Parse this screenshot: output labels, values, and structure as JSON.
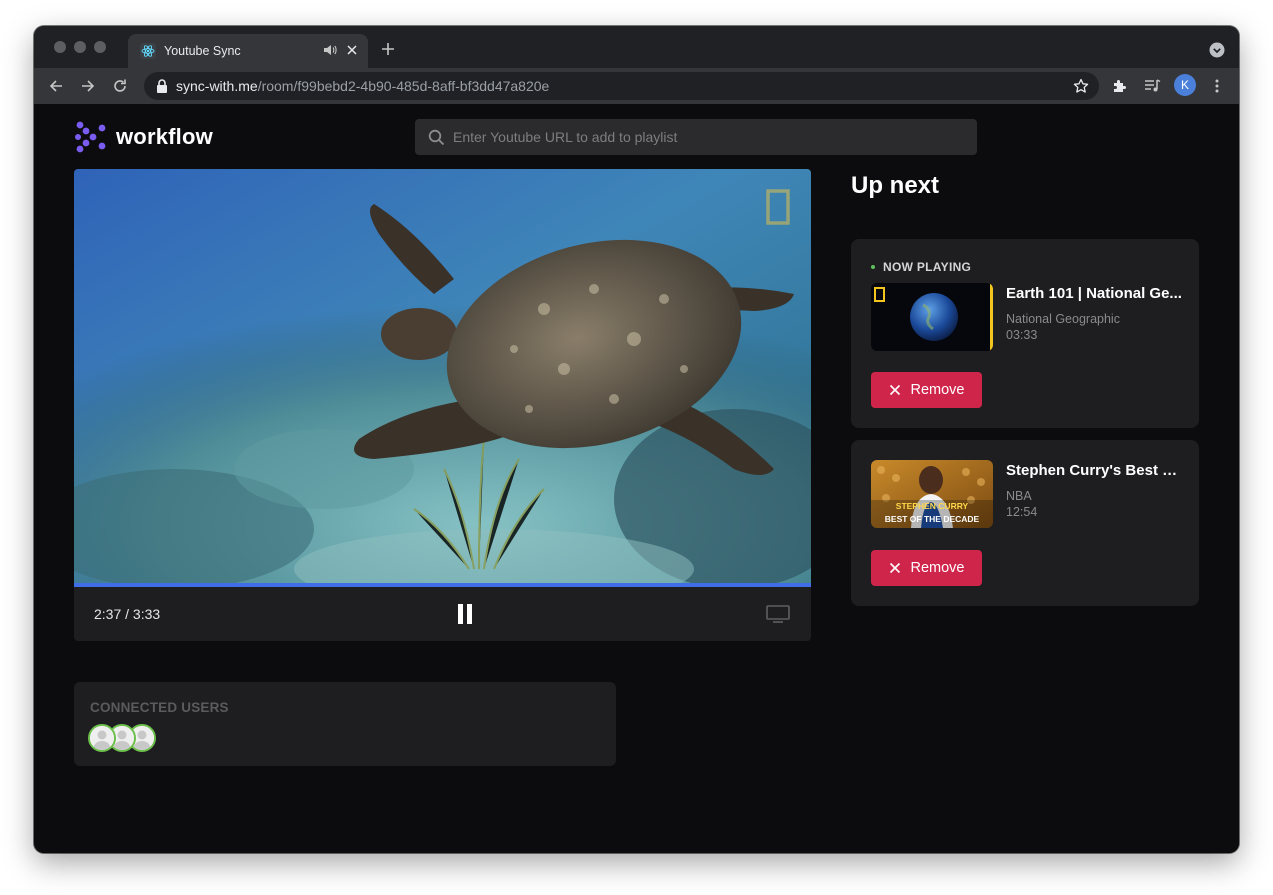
{
  "browser": {
    "tab_title": "Youtube Sync",
    "url_host": "sync-with.me",
    "url_path": "/room/f99bebd2-4b90-485d-8aff-bf3dd47a820e",
    "profile_initial": "K"
  },
  "app": {
    "logo_text": "workflow",
    "search_placeholder": "Enter Youtube URL to add to playlist"
  },
  "player": {
    "time_display": "2:37 / 3:33",
    "progress_fraction": 1.0
  },
  "users": {
    "title": "CONNECTED USERS",
    "count": 3
  },
  "upnext": {
    "title": "Up next",
    "now_playing_label": "NOW PLAYING",
    "items": [
      {
        "title": "Earth 101 | National Ge...",
        "channel": "National Geographic",
        "duration": "03:33",
        "remove_label": "Remove"
      },
      {
        "title": "Stephen Curry's Best Pl...",
        "channel": "NBA",
        "duration": "12:54",
        "remove_label": "Remove",
        "thumb_text_1": "STEPHEN CURRY",
        "thumb_text_2": "BEST OF THE DECADE"
      }
    ]
  },
  "colors": {
    "accent_blue": "#3f6de8",
    "remove_red": "#d0254b",
    "logo_purple": "#7a5cf0"
  }
}
